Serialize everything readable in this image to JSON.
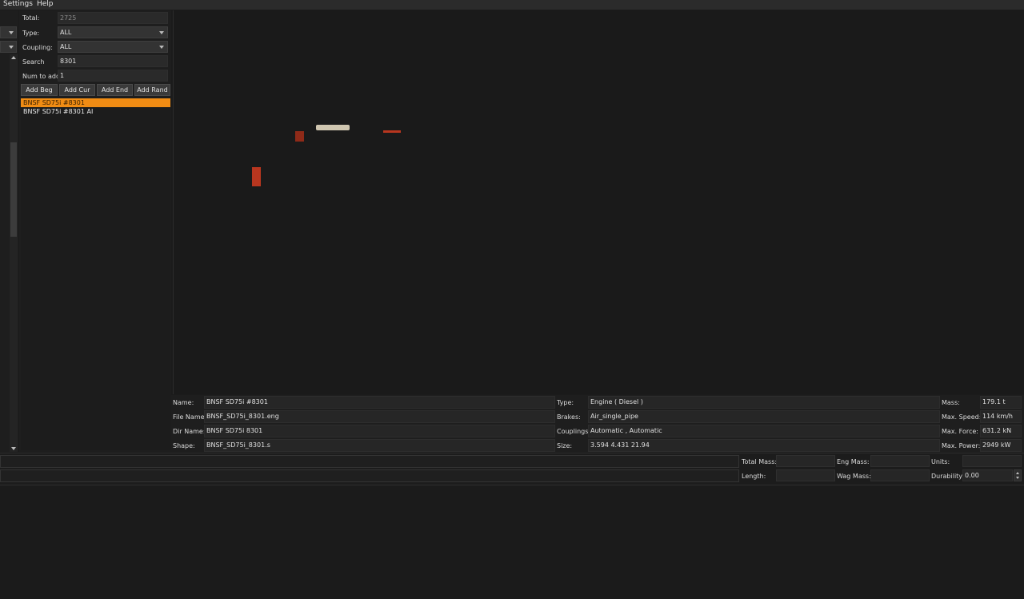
{
  "menu": {
    "settings": "Settings",
    "help": "Help"
  },
  "filters": {
    "total_label": "Total:",
    "total_value": "2725",
    "type_label": "Type:",
    "type_value": "ALL",
    "coupling_label": "Coupling:",
    "coupling_value": "ALL",
    "search_label": "Search",
    "search_value": "8301",
    "num_label": "Num to add",
    "num_value": "1"
  },
  "buttons": {
    "add_beg": "Add Beg",
    "add_cur": "Add Cur",
    "add_end": "Add End",
    "add_rand": "Add Rand"
  },
  "list": [
    "BNSF SD75i #8301",
    "BNSF SD75i #8301 AI"
  ],
  "info": {
    "name_label": "Name:",
    "name_value": "BNSF SD75i #8301",
    "file_label": "File Name:",
    "file_value": "BNSF_SD75i_8301.eng",
    "dir_label": "Dir Name:",
    "dir_value": "BNSF SD75i 8301",
    "shape_label": "Shape:",
    "shape_value": "BNSF_SD75i_8301.s",
    "type_label": "Type:",
    "type_value": "Engine ( Diesel )",
    "brakes_label": "Brakes:",
    "brakes_value": "Air_single_pipe",
    "couplings_label": "Couplings:",
    "couplings_value": "Automatic , Automatic",
    "size_label": "Size:",
    "size_value": "3.594 4.431 21.94",
    "mass_label": "Mass:",
    "mass_value": "179.1 t",
    "speed_label": "Max. Speed:",
    "speed_value": "114 km/h",
    "force_label": "Max. Force:",
    "force_value": "631.2 kN",
    "power_label": "Max. Power:",
    "power_value": "2949 kW"
  },
  "totals": {
    "total_mass_label": "Total Mass:",
    "eng_mass_label": "Eng Mass:",
    "units_label": "Units:",
    "length_label": "Length:",
    "wag_mass_label": "Wag Mass:",
    "durability_label": "Durability:",
    "durability_value": "0.00"
  },
  "colors": {
    "accent": "#f08c14",
    "model_red": "#b8361f",
    "model_beige": "#cfc6b0"
  }
}
